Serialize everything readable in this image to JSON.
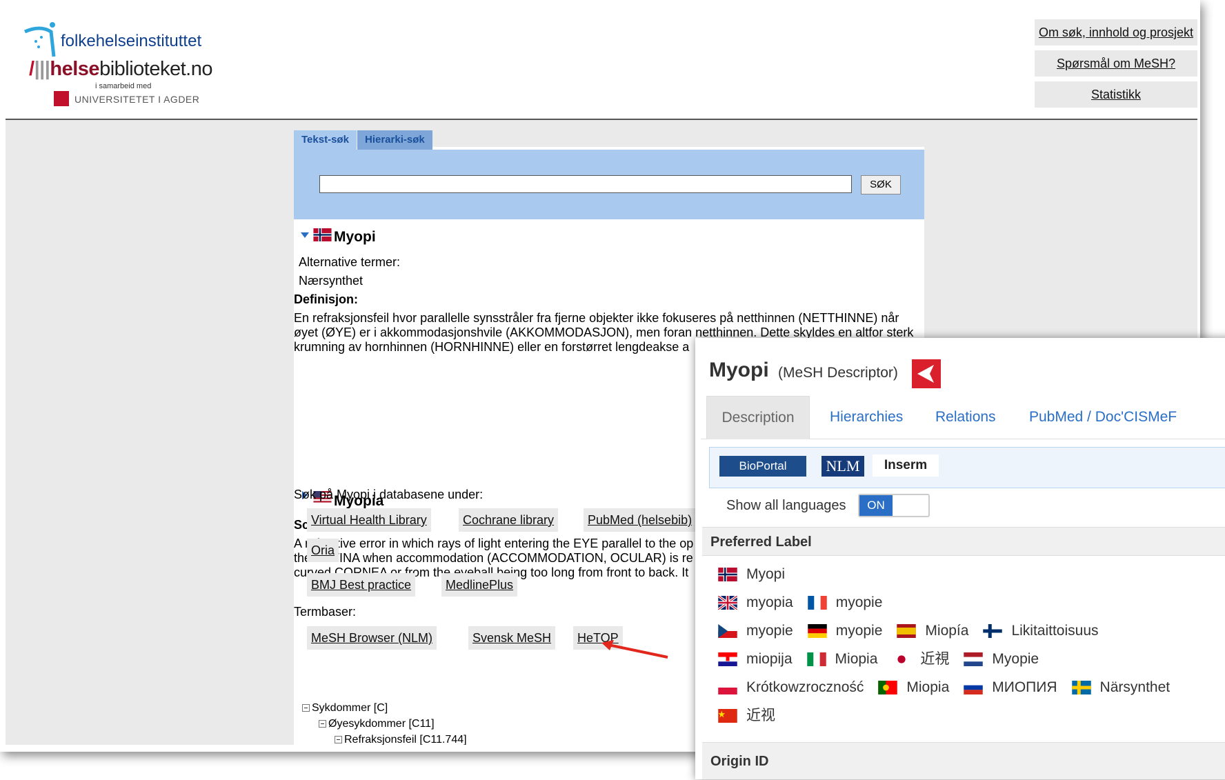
{
  "header": {
    "fhi_logo": "folkehelseinstituttet",
    "hb_logo": {
      "slash": "/",
      "bars": "|||",
      "part1": "helse",
      "part2": "biblioteket.no"
    },
    "samarbeid": "i samarbeid med",
    "uia_logo": "UNIVERSITETET I AGDER",
    "links": [
      "Om søk, innhold og prosjekt",
      "Spørsmål om MeSH?",
      "Statistikk"
    ]
  },
  "search": {
    "tabs": [
      "Tekst-søk",
      "Hierarki-søk"
    ],
    "button": "SØK",
    "value": ""
  },
  "entry_no": {
    "title": "Myopi",
    "alt_label": "Alternative termer:",
    "alt_term": "Nærsynthet",
    "def_label": "Definisjon:",
    "def_lines": [
      "En refraksjonsfeil hvor parallelle synsstråler fra fjerne objekter ikke fokuseres på netthinnen (NETTHINNE) når",
      "øyet (ØYE) er i akkommodasjonshvile (AKKOMMODASJON), men foran netthinnen. Dette skyldes en altfor sterk",
      "krumning av hornhinnen (HORNHINNE) eller en forstørret lengdeakse a"
    ]
  },
  "entry_en": {
    "title": "Myopia",
    "scope_label": "Scope-Note:",
    "scope_lines": [
      "A refractive error in which rays of light entering the EYE parallel to the op",
      "the RETINA when accommodation (ACCOMMODATION, OCULAR) is re",
      "curved CORNEA or from the eyeball being too long from front to back. It"
    ]
  },
  "databases": {
    "intro": "Søk på Myopi i databasene under:",
    "row1": [
      "Virtual Health Library",
      "Cochrane library",
      "PubMed (helsebib)"
    ],
    "row2": [
      "Oria"
    ],
    "row3": [
      "BMJ Best practice",
      "MedlinePlus"
    ],
    "termbaser_label": "Termbaser:",
    "termbaser": [
      "MeSH Browser (NLM)",
      "Svensk MeSH",
      "HeTOP"
    ]
  },
  "tree": [
    "Sykdommer [C]",
    "Øyesykdommer [C11]",
    "Refraksjonsfeil [C11.744]"
  ],
  "popup": {
    "title": "Myopi",
    "subtitle": "(MeSH Descriptor)",
    "tabs": [
      "Description",
      "Hierarchies",
      "Relations",
      "PubMed / Doc'CISMeF"
    ],
    "logos": {
      "bioportal": "BioPortal",
      "nlm": "NLM",
      "inserm": "Inserm"
    },
    "show_languages": "Show all languages",
    "toggle": "ON",
    "preferred_label": "Preferred Label",
    "origin": "Origin ID",
    "labels": [
      [
        {
          "flag": "no",
          "text": "Myopi"
        }
      ],
      [
        {
          "flag": "gb",
          "text": "myopia"
        },
        {
          "flag": "fr",
          "text": "myopie"
        }
      ],
      [
        {
          "flag": "cz",
          "text": "myopie"
        },
        {
          "flag": "de",
          "text": "myopie"
        },
        {
          "flag": "es",
          "text": "Miopía"
        },
        {
          "flag": "fi",
          "text": "Likitaittoisuus"
        }
      ],
      [
        {
          "flag": "hr",
          "text": "miopija"
        },
        {
          "flag": "it",
          "text": "Miopia"
        },
        {
          "flag": "jp",
          "text": "近視"
        },
        {
          "flag": "nl",
          "text": "Myopie"
        }
      ],
      [
        {
          "flag": "pl",
          "text": "Krótkowzroczność"
        },
        {
          "flag": "pt",
          "text": "Miopia"
        },
        {
          "flag": "ru",
          "text": "МИОПИЯ"
        },
        {
          "flag": "se",
          "text": "Närsynthet"
        }
      ],
      [
        {
          "flag": "cn",
          "text": "近视"
        }
      ]
    ]
  }
}
